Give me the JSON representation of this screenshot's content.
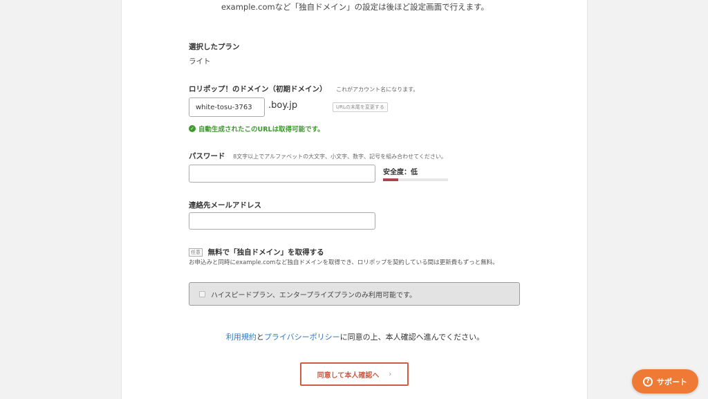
{
  "top_note": "example.comなど「独自ドメイン」の設定は後ほど設定画面で行えます。",
  "plan": {
    "label": "選択したプラン",
    "value": "ライト"
  },
  "domain": {
    "label": "ロリポップ！のドメイン（初期ドメイン）",
    "note": "これがアカウント名になります。",
    "value": "white-tosu-3763",
    "suffix": ".boy.jp",
    "change_button": "URLの末尾を変更する",
    "ok_message": "自動生成されたこのURLは取得可能です。"
  },
  "password": {
    "label": "パスワード",
    "note": "8文字以上でアルファベットの大文字、小文字、数字、記号を組み合わせてください。",
    "value": "",
    "strength_label": "安全度：低",
    "strength_level": 0.23,
    "strength_color": "#a8454f"
  },
  "email": {
    "label": "連絡先メールアドレス",
    "value": ""
  },
  "free_domain": {
    "tag": "任意",
    "title": "無料で「独自ドメイン」を取得する",
    "description": "お申込みと同時にexample.comなど独自ドメインを取得でき、ロリポップを契約している間は更新費もずっと無料。",
    "disabled_option": "ハイスピードプラン、エンタープライズプランのみ利用可能です。"
  },
  "agreement": {
    "terms_link": "利用規約",
    "and": "と",
    "privacy_link": "プライバシーポリシー",
    "rest": "に同意の上、本人確認へ進んでください。"
  },
  "agree_button": {
    "label": "同意して本人確認へ",
    "icon": "chevron-right-icon"
  },
  "support_button": {
    "label": "サポート",
    "icon": "question-circle-icon",
    "color": "#ef7a36"
  },
  "colors": {
    "accent": "#d25a40",
    "link": "#2e78c6",
    "success": "#3c9a2c"
  }
}
